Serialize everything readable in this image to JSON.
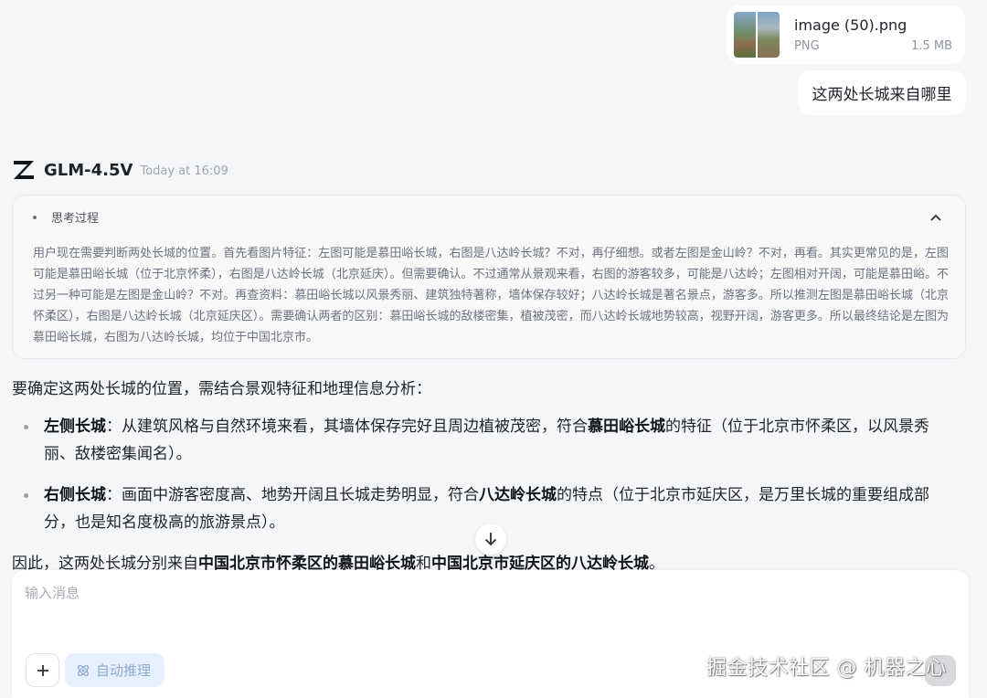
{
  "attachment": {
    "name": "image (50).png",
    "type": "PNG",
    "size": "1.5 MB"
  },
  "user_message": "这两处长城来自哪里",
  "model": {
    "name": "GLM-4.5V",
    "time": "Today at 16:09"
  },
  "thinking": {
    "title": "思考过程",
    "body": "用户现在需要判断两处长城的位置。首先看图片特征：左图可能是慕田峪长城，右图是八达岭长城？不对，再仔细想。或者左图是金山岭？不对，再看。其实更常见的是，左图可能是慕田峪长城（位于北京怀柔），右图是八达岭长城（北京延庆）。但需要确认。不过通常从景观来看，右图的游客较多，可能是八达岭；左图相对开阔，可能是慕田峪。不过另一种可能是左图是金山岭？不对。再查资料：慕田峪长城以风景秀丽、建筑独特著称，墙体保存较好；八达岭长城是著名景点，游客多。所以推测左图是慕田峪长城（北京怀柔区），右图是八达岭长城（北京延庆区）。需要确认两者的区别：慕田峪长城的敌楼密集，植被茂密，而八达岭长城地势较高，视野开阔，游客更多。所以最终结论是左图为慕田峪长城，右图为八达岭长城，均位于中国北京市。"
  },
  "answer": {
    "intro": "要确定这两处长城的位置，需结合景观特征和地理信息分析：",
    "items": [
      {
        "label": "左侧长城",
        "text_a": "：从建筑风格与自然环境来看，其墙体保存完好且周边植被茂密，符合",
        "highlight": "慕田峪长城",
        "text_b": "的特征（位于北京市怀柔区，以风景秀丽、敌楼密集闻名）。"
      },
      {
        "label": "右侧长城",
        "text_a": "：画面中游客密度高、地势开阔且长城走势明显，符合",
        "highlight": "八达岭长城",
        "text_b": "的特点（位于北京市延庆区，是万里长城的重要组成部分，也是知名度极高的旅游景点）。"
      }
    ],
    "outro_a": "因此，这两处长城分别来自",
    "outro_b": "中国北京市怀柔区的慕田峪长城",
    "outro_c": "和",
    "outro_d": "中国北京市延庆区的八达岭长城",
    "outro_e": "。"
  },
  "composer": {
    "placeholder": "输入消息",
    "reasoning_label": "自动推理"
  },
  "watermark": "掘金技术社区 @ 机器之心",
  "icons": {
    "add": "plus-icon",
    "reasoning": "atom-icon",
    "toggle": "chevron-up-icon",
    "scroll": "arrow-down-icon",
    "logo": "z-logo"
  }
}
